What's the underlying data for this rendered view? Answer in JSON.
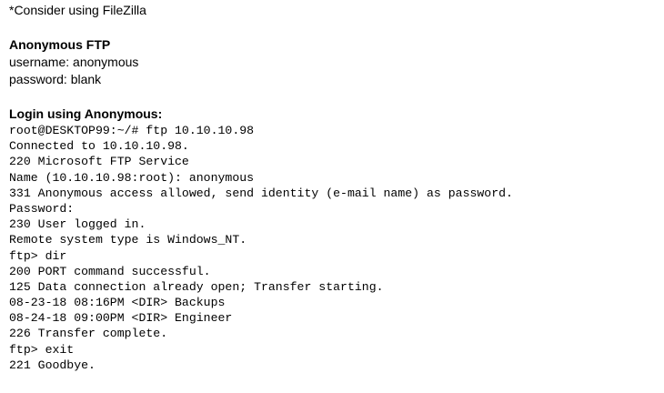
{
  "note": "*Consider using FileZilla",
  "anonymous_section": {
    "heading": "Anonymous FTP",
    "username": "username: anonymous",
    "password": "password: blank"
  },
  "login_section": {
    "heading": "Login using Anonymous:",
    "terminal_lines": [
      "root@DESKTOP99:~/# ftp 10.10.10.98",
      "Connected to 10.10.10.98.",
      "220 Microsoft FTP Service",
      "Name (10.10.10.98:root): anonymous",
      "331 Anonymous access allowed, send identity (e-mail name) as password.",
      "Password:",
      "230 User logged in.",
      "Remote system type is Windows_NT.",
      "ftp> dir",
      "200 PORT command successful.",
      "125 Data connection already open; Transfer starting.",
      "08-23-18 08:16PM <DIR> Backups",
      "08-24-18 09:00PM <DIR> Engineer",
      "226 Transfer complete.",
      "ftp> exit",
      "221 Goodbye."
    ]
  }
}
